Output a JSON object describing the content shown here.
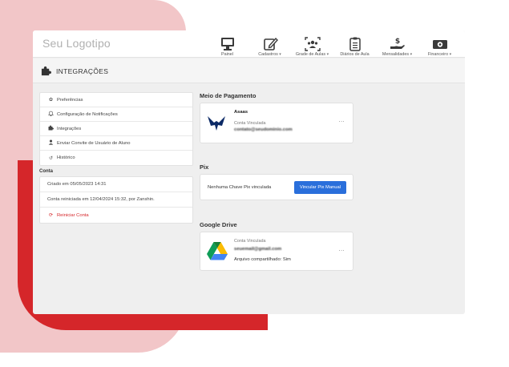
{
  "colors": {
    "accent": "#d5262a",
    "bg_pink": "#f2c6c8",
    "primary": "#2a6fdb"
  },
  "app": {
    "logo": "Seu Logotipo"
  },
  "nav": [
    {
      "label": "Painel",
      "caret": "",
      "icon": "monitor-icon"
    },
    {
      "label": "Cadastros",
      "caret": "▾",
      "icon": "edit-icon"
    },
    {
      "label": "Grade de Aulas",
      "caret": "▾",
      "icon": "people-grid-icon"
    },
    {
      "label": "Diários de Aula",
      "caret": "",
      "icon": "clipboard-icon"
    },
    {
      "label": "Mensalidades",
      "caret": "▾",
      "icon": "hand-money-icon"
    },
    {
      "label": "Financeiro",
      "caret": "▾",
      "icon": "banknote-icon"
    }
  ],
  "page": {
    "title": "INTEGRAÇÕES",
    "icon": "puzzle-icon"
  },
  "menu": [
    {
      "label": "Preferências",
      "icon": "gear-icon",
      "glyph": "✿"
    },
    {
      "label": "Configuração de Notificações",
      "icon": "bell-icon",
      "glyph": "🔔"
    },
    {
      "label": "Integrações",
      "icon": "puzzle-icon",
      "glyph": "✚"
    },
    {
      "label": "Enviar Convite de Usuário de Aluno",
      "icon": "user-icon",
      "glyph": "●"
    },
    {
      "label": "Histórico",
      "icon": "history-icon",
      "glyph": "↺"
    }
  ],
  "conta": {
    "label": "Conta",
    "created": "Criado em 05/05/2023 14:31",
    "restarted": "Conta reiniciada em 12/04/2024 15:32, por Zanshin.",
    "restart_action": "Reiniciar Conta"
  },
  "payment": {
    "title": "Meio de Pagamento",
    "provider": "Asaas",
    "status": "Conta Vinculada",
    "email": "contato@seudominio.com",
    "more": "..."
  },
  "pix": {
    "title": "Pix",
    "empty": "Nenhuma Chave Pix vinculada",
    "button": "Vincular Pix Manual"
  },
  "drive": {
    "title": "Google Drive",
    "status": "Conta Vinculada",
    "email": "seuemail@gmail.com",
    "shared": "Arquivo compartilhado: Sim",
    "more": "..."
  }
}
